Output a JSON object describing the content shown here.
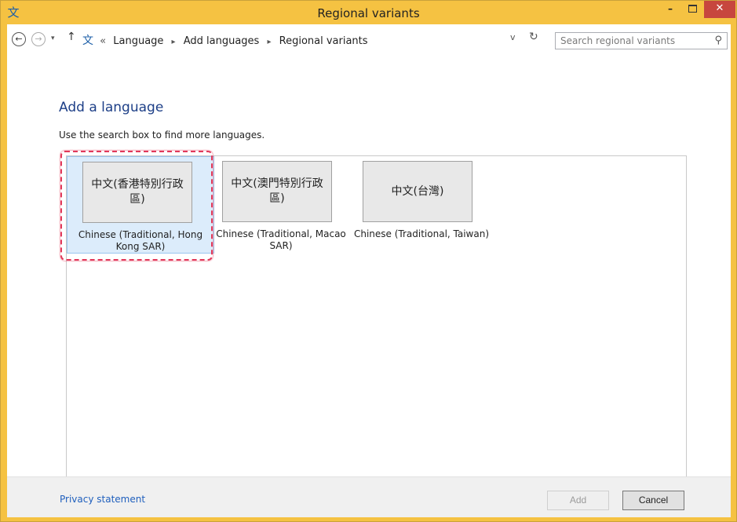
{
  "window": {
    "title": "Regional variants",
    "minimize_glyph": "–",
    "close_glyph": "✕"
  },
  "nav": {
    "back_icon": "back-arrow-icon",
    "forward_icon": "forward-arrow-icon",
    "recent_glyph": "▾",
    "up_glyph": "↑",
    "back_glyph": "←",
    "forward_glyph": "→",
    "overflow": "«",
    "breadcrumbs": [
      "Language",
      "Add languages",
      "Regional variants"
    ],
    "dropdown_glyph": "v",
    "refresh_glyph": "↻",
    "search_placeholder": "Search regional variants",
    "search_glyph": "⚲"
  },
  "main": {
    "heading": "Add a language",
    "subtext": "Use the search box to find more languages."
  },
  "variants": [
    {
      "native": "中文(香港特別行政區)",
      "label": "Chinese (Traditional, Hong Kong SAR)",
      "selected": true
    },
    {
      "native": "中文(澳門特別行政區)",
      "label": "Chinese (Traditional, Macao SAR)",
      "selected": false
    },
    {
      "native": "中文(台灣)",
      "label": "Chinese (Traditional, Taiwan)",
      "selected": false
    }
  ],
  "footer": {
    "privacy": "Privacy statement",
    "add_label": "Add",
    "cancel_label": "Cancel"
  },
  "colors": {
    "title_bar": "#f5c242",
    "heading": "#1d3f87",
    "link": "#1f5fbd",
    "selection": "#dcecfb",
    "highlight_outline": "#e1395a",
    "close_button": "#c7463e"
  }
}
